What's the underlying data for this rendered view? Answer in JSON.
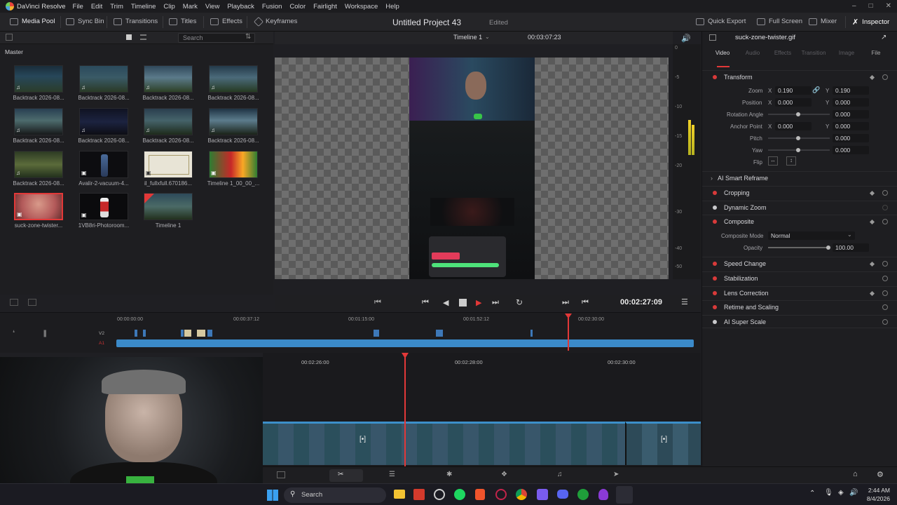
{
  "app": {
    "name": "DaVinci Resolve"
  },
  "menu": [
    "File",
    "Edit",
    "Trim",
    "Timeline",
    "Clip",
    "Mark",
    "View",
    "Playback",
    "Fusion",
    "Color",
    "Fairlight",
    "Workspace",
    "Help"
  ],
  "toolbar": {
    "media_pool": "Media Pool",
    "sync_bin": "Sync Bin",
    "transitions": "Transitions",
    "titles": "Titles",
    "effects": "Effects",
    "keyframes": "Keyframes",
    "quick_export": "Quick Export",
    "full_screen": "Full Screen",
    "mixer": "Mixer",
    "inspector": "Inspector"
  },
  "project": {
    "title": "Untitled Project 43",
    "status": "Edited"
  },
  "media_pool": {
    "bin": "Master",
    "search_placeholder": "Search",
    "clips": [
      {
        "label": "Backtrack 2026-08...",
        "type": "audio"
      },
      {
        "label": "Backtrack 2026-08...",
        "type": "audio"
      },
      {
        "label": "Backtrack 2026-08...",
        "type": "audio"
      },
      {
        "label": "Backtrack 2026-08...",
        "type": "audio"
      },
      {
        "label": "Backtrack 2026-08...",
        "type": "audio"
      },
      {
        "label": "Backtrack 2026-08...",
        "type": "audio"
      },
      {
        "label": "Backtrack 2026-08...",
        "type": "audio"
      },
      {
        "label": "Backtrack 2026-08...",
        "type": "audio"
      },
      {
        "label": "Backtrack 2026-08...",
        "type": "audio"
      },
      {
        "label": "Avalir-2-vacuum-4...",
        "type": "image"
      },
      {
        "label": "il_fullxfull.670186...",
        "type": "image"
      },
      {
        "label": "Timeline 1_00_00_...",
        "type": "image"
      },
      {
        "label": "suck-zone-twister...",
        "type": "image",
        "selected": true
      },
      {
        "label": "1VB8ri-Photoroom...",
        "type": "image"
      },
      {
        "label": "Timeline 1",
        "type": "timeline"
      }
    ]
  },
  "viewer": {
    "timeline_name": "Timeline 1",
    "duration": "00:03:07:23",
    "timecode": "00:02:27:09"
  },
  "timeline_upper": {
    "ruler": [
      "00:00:00:00",
      "00:00:37:12",
      "00:01:15:00",
      "00:01:52:12",
      "00:02:30:00"
    ],
    "tracks": [
      "V2",
      "A1"
    ]
  },
  "timeline_lower": {
    "ruler": [
      "00:02:26:00",
      "00:02:28:00",
      "00:02:30:00"
    ]
  },
  "inspector": {
    "clip_name": "suck-zone-twister.gif",
    "tabs": [
      "Video",
      "Audio",
      "Effects",
      "Transition",
      "Image",
      "File"
    ],
    "sections": {
      "transform": "Transform",
      "smart_reframe": "AI Smart Reframe",
      "cropping": "Cropping",
      "dynamic_zoom": "Dynamic Zoom",
      "composite": "Composite",
      "speed_change": "Speed Change",
      "stabilization": "Stabilization",
      "lens_correction": "Lens Correction",
      "retime": "Retime and Scaling",
      "super_scale": "AI Super Scale"
    },
    "props": {
      "zoom": "Zoom",
      "zoom_x": "0.190",
      "zoom_y": "0.190",
      "position": "Position",
      "pos_x": "0.000",
      "pos_y": "0.000",
      "rotation": "Rotation Angle",
      "rotation_v": "0.000",
      "anchor": "Anchor Point",
      "anchor_x": "0.000",
      "anchor_y": "0.000",
      "pitch": "Pitch",
      "pitch_v": "0.000",
      "yaw": "Yaw",
      "yaw_v": "0.000",
      "flip": "Flip",
      "composite_mode": "Composite Mode",
      "composite_mode_v": "Normal",
      "opacity": "Opacity",
      "opacity_v": "100.00",
      "x": "X",
      "y": "Y"
    }
  },
  "meter_ticks": [
    "0",
    "-5",
    "-10",
    "-15",
    "-20",
    "-30",
    "-40",
    "-50"
  ],
  "taskbar": {
    "search": "Search",
    "time": "2:44 AM",
    "date": "8/4/2026"
  }
}
